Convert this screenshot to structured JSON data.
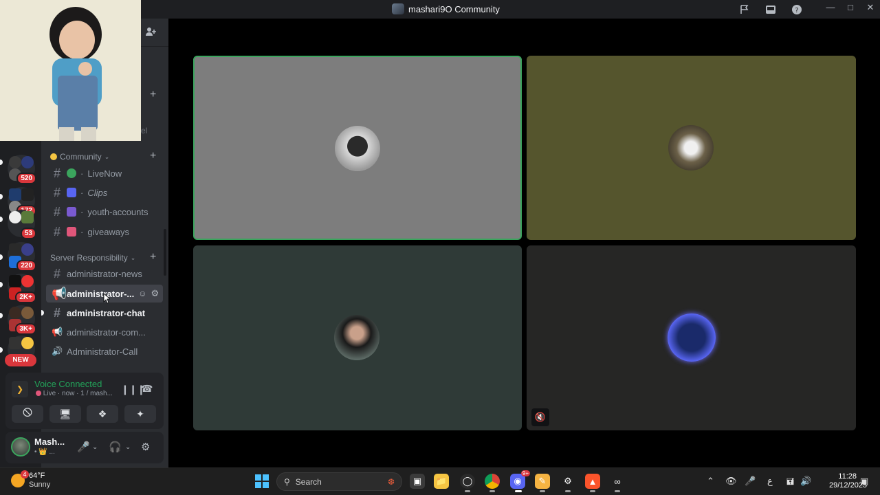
{
  "window": {
    "title": "mashari9O Community"
  },
  "sidebar": {
    "categories": [
      {
        "label": "Community"
      },
      {
        "label": "Server Responsibility"
      }
    ],
    "channels": [
      {
        "label": "LiveNow"
      },
      {
        "label": "Clips"
      },
      {
        "label": "youth-accounts"
      },
      {
        "label": "giveaways"
      },
      {
        "label": "administrator-news"
      },
      {
        "label": "administrator-..."
      },
      {
        "label": "administrator-chat"
      },
      {
        "label": "administrator-com..."
      },
      {
        "label": "Administrator-Call"
      }
    ],
    "dot": "·"
  },
  "guilds": {
    "badges": [
      "520",
      "172",
      "53",
      "220",
      "2K+",
      "3K+"
    ],
    "new_label": "NEW"
  },
  "voice": {
    "status": "Voice Connected",
    "detail": "Live · now · 1 / mash..."
  },
  "user": {
    "name": "Mash...",
    "status": "• 👑 ..."
  },
  "taskbar": {
    "weather_temp": "64°F",
    "weather_cond": "Sunny",
    "weather_badge": "4",
    "search_placeholder": "Search",
    "discord_badge": "9+",
    "ime": "ع",
    "time": "11:28",
    "date": "29/12/2025"
  },
  "colors": {
    "voice_green": "#23a55a",
    "badge_red": "#da373c",
    "speaking_border": "#3ba55d"
  }
}
